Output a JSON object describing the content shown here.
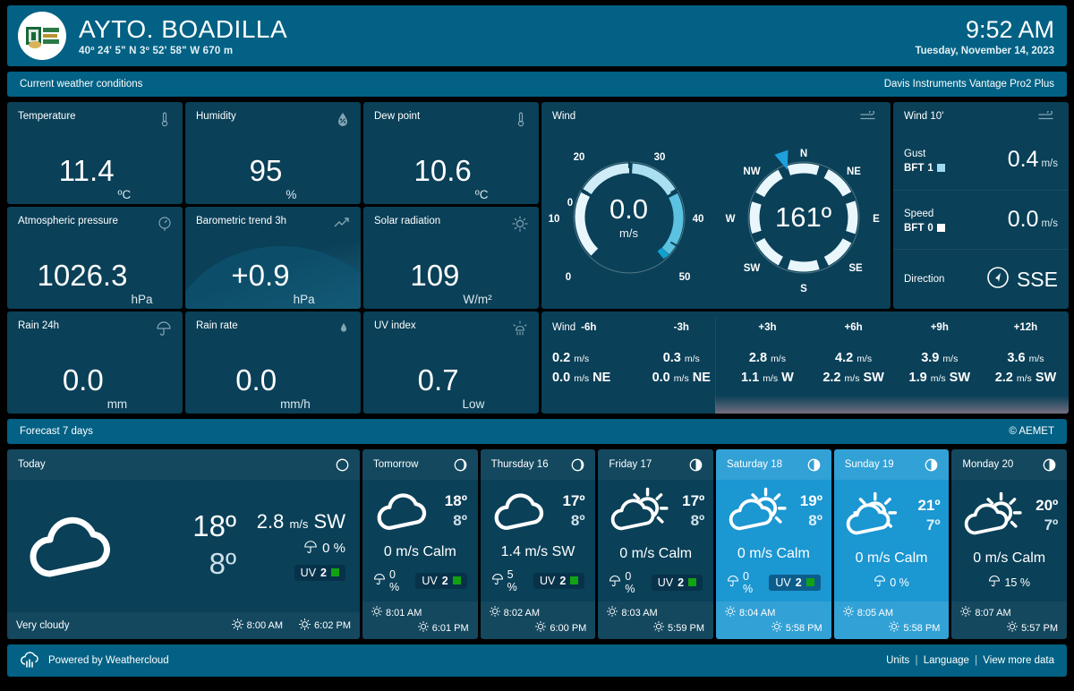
{
  "header": {
    "station_name": "AYTO. BOADILLA",
    "coords": "40º 24' 5\" N   3º 52' 58\" W   670 m",
    "time": "9:52 AM",
    "date": "Tuesday, November 14, 2023",
    "logo_alt": "station-logo"
  },
  "current_section": {
    "title": "Current weather conditions",
    "device": "Davis Instruments Vantage Pro2 Plus"
  },
  "cards": {
    "temperature": {
      "title": "Temperature",
      "value": "11.4",
      "unit": "ºC",
      "icon": "thermometer-icon"
    },
    "humidity": {
      "title": "Humidity",
      "value": "95",
      "unit": "%",
      "icon": "droplet-percent-icon"
    },
    "dewpoint": {
      "title": "Dew point",
      "value": "10.6",
      "unit": "ºC",
      "icon": "thermometer-icon"
    },
    "pressure": {
      "title": "Atmospheric pressure",
      "value": "1026.3",
      "unit": "hPa",
      "icon": "gauge-icon"
    },
    "baro_trend": {
      "title": "Barometric trend 3h",
      "value": "+0.9",
      "unit": "hPa",
      "icon": "trend-up-icon"
    },
    "solar": {
      "title": "Solar radiation",
      "value": "109",
      "unit": "W/m²",
      "icon": "sun-icon"
    },
    "rain24": {
      "title": "Rain 24h",
      "value": "0.0",
      "unit": "mm",
      "icon": "umbrella-icon"
    },
    "rain_rate": {
      "title": "Rain rate",
      "value": "0.0",
      "unit": "mm/h",
      "icon": "raindrop-icon"
    },
    "uv": {
      "title": "UV index",
      "value": "0.7",
      "unit": "Low",
      "icon": "uv-sun-icon"
    }
  },
  "wind": {
    "title": "Wind",
    "icon": "wind-icon",
    "speed": {
      "value": "0.0",
      "unit": "m/s",
      "min": 0,
      "max": 50,
      "ticks": [
        "0",
        "10",
        "20",
        "30",
        "40",
        "50"
      ]
    },
    "direction": {
      "value": "161º",
      "degrees": 161,
      "points": [
        "N",
        "NE",
        "E",
        "SE",
        "S",
        "SW",
        "W",
        "NW"
      ]
    }
  },
  "wind10": {
    "title": "Wind 10'",
    "icon": "wind-icon",
    "rows": [
      {
        "label": "Gust",
        "bft_label": "BFT",
        "bft": "1",
        "bft_color": "#9ed9ef",
        "value": "0.4",
        "unit": "m/s"
      },
      {
        "label": "Speed",
        "bft_label": "BFT",
        "bft": "0",
        "bft_color": "#ffffff",
        "value": "0.0",
        "unit": "m/s"
      }
    ],
    "direction_label": "Direction",
    "direction_value": "SSE",
    "direction_icon": "compass-icon"
  },
  "wind_forecast": {
    "label": "Wind",
    "columns": [
      {
        "time": "-6h",
        "speed": "0.2",
        "unit": "m/s",
        "gust": "0.0",
        "gust_unit": "m/s",
        "dir": "NE"
      },
      {
        "time": "-3h",
        "speed": "0.3",
        "unit": "m/s",
        "gust": "0.0",
        "gust_unit": "m/s",
        "dir": "NE"
      },
      {
        "time": "+3h",
        "speed": "2.8",
        "unit": "m/s",
        "gust": "1.1",
        "gust_unit": "m/s",
        "dir": "W"
      },
      {
        "time": "+6h",
        "speed": "4.2",
        "unit": "m/s",
        "gust": "2.2",
        "gust_unit": "m/s",
        "dir": "SW"
      },
      {
        "time": "+9h",
        "speed": "3.9",
        "unit": "m/s",
        "gust": "1.9",
        "gust_unit": "m/s",
        "dir": "SW"
      },
      {
        "time": "+12h",
        "speed": "3.6",
        "unit": "m/s",
        "gust": "2.2",
        "gust_unit": "m/s",
        "dir": "SW"
      }
    ]
  },
  "forecast_section": {
    "title": "Forecast 7 days",
    "source": "© AEMET"
  },
  "forecast": {
    "today": {
      "day": "Today",
      "moon": "new-moon-icon",
      "icon": "cloud-icon",
      "hi": "18º",
      "lo": "8º",
      "wind_speed": "2.8",
      "wind_unit": "m/s",
      "wind_dir": "SW",
      "rain": "0 %",
      "rain_icon": "umbrella-icon",
      "uv_label": "UV",
      "uv_value": "2",
      "uv_color": "#12a312",
      "condition": "Very cloudy",
      "sunrise": "8:00 AM",
      "sunset": "6:02 PM",
      "highlight": false
    },
    "days": [
      {
        "day": "Tomorrow",
        "moon": "waxing-crescent-icon",
        "icon": "cloud-icon",
        "hi": "18º",
        "lo": "8º",
        "wind": "0 m/s Calm",
        "rain": "0 %",
        "uv_label": "UV",
        "uv_value": "2",
        "uv_color": "#12a312",
        "sunrise": "8:01 AM",
        "sunset": "6:01 PM",
        "highlight": false
      },
      {
        "day": "Thursday 16",
        "moon": "waxing-crescent-icon",
        "icon": "cloud-icon",
        "hi": "17º",
        "lo": "8º",
        "wind": "1.4 m/s SW",
        "rain": "5 %",
        "uv_label": "UV",
        "uv_value": "2",
        "uv_color": "#12a312",
        "sunrise": "8:02 AM",
        "sunset": "6:00 PM",
        "highlight": false
      },
      {
        "day": "Friday 17",
        "moon": "first-quarter-icon",
        "icon": "sun-behind-cloud-icon",
        "hi": "17º",
        "lo": "8º",
        "wind": "0 m/s Calm",
        "rain": "0 %",
        "uv_label": "UV",
        "uv_value": "2",
        "uv_color": "#12a312",
        "sunrise": "8:03 AM",
        "sunset": "5:59 PM",
        "highlight": false
      },
      {
        "day": "Saturday 18",
        "moon": "first-quarter-icon",
        "icon": "sun-behind-cloud-icon",
        "hi": "19º",
        "lo": "8º",
        "wind": "0 m/s Calm",
        "rain": "0 %",
        "uv_label": "UV",
        "uv_value": "2",
        "uv_color": "#12a312",
        "sunrise": "8:04 AM",
        "sunset": "5:58 PM",
        "highlight": true
      },
      {
        "day": "Sunday 19",
        "moon": "first-quarter-icon",
        "icon": "sun-behind-cloud-icon",
        "hi": "21º",
        "lo": "7º",
        "wind": "0 m/s Calm",
        "rain": "0 %",
        "uv_label": "",
        "uv_value": "",
        "uv_color": "",
        "sunrise": "8:05 AM",
        "sunset": "5:58 PM",
        "highlight": true
      },
      {
        "day": "Monday 20",
        "moon": "first-quarter-icon",
        "icon": "sun-behind-cloud-icon",
        "hi": "20º",
        "lo": "7º",
        "wind": "0 m/s Calm",
        "rain": "15 %",
        "uv_label": "",
        "uv_value": "",
        "uv_color": "",
        "sunrise": "8:07 AM",
        "sunset": "5:57 PM",
        "highlight": false
      }
    ]
  },
  "footer": {
    "powered_by": "Powered by Weathercloud",
    "logo": "weathercloud-icon",
    "units": "Units",
    "language": "Language",
    "view_more": "View more data",
    "separator": "|"
  },
  "colors": {
    "header_bar": "#026184",
    "card_bg": "#0a4058",
    "highlight_bg": "#1b97d2",
    "page_bg": "#000000",
    "accent_cyan": "#12a0cf"
  }
}
